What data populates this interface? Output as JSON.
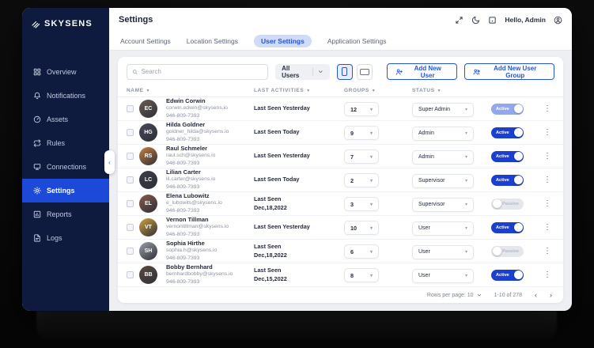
{
  "sidebar": {
    "logo_text": "SKYSENS",
    "logo_icon": "waves-signal-icon",
    "items": [
      {
        "label": "Overview",
        "icon": "dashboard-grid-icon"
      },
      {
        "label": "Notifications",
        "icon": "bell-icon"
      },
      {
        "label": "Assets",
        "icon": "gauge-icon"
      },
      {
        "label": "Rules",
        "icon": "repeat-arrows-icon"
      },
      {
        "label": "Connections",
        "icon": "monitor-icon"
      },
      {
        "label": "Settings",
        "icon": "gear-icon"
      },
      {
        "label": "Reports",
        "icon": "bar-chart-icon"
      },
      {
        "label": "Logs",
        "icon": "document-icon"
      }
    ],
    "active_item": "Settings",
    "collapse_icon": "chevron-left-icon"
  },
  "header": {
    "title": "Settings",
    "icons": [
      "expand-icon",
      "moon-icon",
      "inbox-box-icon"
    ],
    "greeting": "Hello, Admin",
    "account_icon": "account-circle-icon"
  },
  "tabs": {
    "items": [
      {
        "label": "Account Settings",
        "active": false
      },
      {
        "label": "Location Settings",
        "active": false
      },
      {
        "label": "User Settings",
        "active": true
      },
      {
        "label": "Application Settings",
        "active": false
      }
    ]
  },
  "toolbar": {
    "search_placeholder": "Search",
    "filter_value": "All Users",
    "add_user_label": "Add New User",
    "add_user_group_label": "Add New User Group",
    "accent_color": "#2453e0"
  },
  "table": {
    "columns": [
      "Name",
      "Last Activities",
      "Groups",
      "Status"
    ],
    "rows": [
      {
        "name": "Edwin Corwin",
        "email": "corwin.edwin@skysens.io",
        "phone": "946-809-7393",
        "last_seen": "Last Seen Yesterday",
        "groups": "12",
        "role": "Super Admin",
        "toggle_label": "Active",
        "toggle_state": "active",
        "toggle_variant": "light",
        "initials": "EC",
        "avatar_color": "#6b5d52"
      },
      {
        "name": "Hilda Goldner",
        "email": "goldner_hilda@skysens.io",
        "phone": "946-809-7393",
        "last_seen": "Last Seen Today",
        "groups": "9",
        "role": "Admin",
        "toggle_label": "Active",
        "toggle_state": "active",
        "toggle_variant": "",
        "initials": "HG",
        "avatar_color": "#47485a"
      },
      {
        "name": "Raul Schmeler",
        "email": "raul.sch@skysens.io",
        "phone": "946-809-7393",
        "last_seen": "Last Seen Yesterday",
        "groups": "7",
        "role": "Admin",
        "toggle_label": "Active",
        "toggle_state": "active",
        "toggle_variant": "",
        "initials": "RS",
        "avatar_color": "#c97f3c"
      },
      {
        "name": "Lilian Carter",
        "email": "lil.carter@skysens.io",
        "phone": "946-809-7393",
        "last_seen": "Last Seen Today",
        "groups": "2",
        "role": "Supervisor",
        "toggle_label": "Active",
        "toggle_state": "active",
        "toggle_variant": "",
        "initials": "LC",
        "avatar_color": "#3c3d49"
      },
      {
        "name": "Elena Lubowitz",
        "email": "e_lubowits@skysens.io",
        "phone": "946-809-7393",
        "last_seen": "Last Seen\nDec,18,2022",
        "groups": "3",
        "role": "Supervisor",
        "toggle_label": "Passive",
        "toggle_state": "passive",
        "toggle_variant": "",
        "initials": "EL",
        "avatar_color": "#8a5a4c"
      },
      {
        "name": "Vernon Tillman",
        "email": "vernontillman@skysens.io",
        "phone": "946-809-7393",
        "last_seen": "Last Seen Yesterday",
        "groups": "10",
        "role": "User",
        "toggle_label": "Active",
        "toggle_state": "active",
        "toggle_variant": "",
        "initials": "VT",
        "avatar_color": "#d2a23e"
      },
      {
        "name": "Sophia Hirthe",
        "email": "sophia.h@skysens.io",
        "phone": "946-809-7393",
        "last_seen": "Last Seen\nDec,18,2022",
        "groups": "6",
        "role": "User",
        "toggle_label": "Passive",
        "toggle_state": "passive",
        "toggle_variant": "",
        "initials": "SH",
        "avatar_color": "#9aa0a8"
      },
      {
        "name": "Bobby Bernhard",
        "email": "bernhardbobby@skysens.io",
        "phone": "946-809-7393",
        "last_seen": "Last Seen\nDec,15,2022",
        "groups": "8",
        "role": "User",
        "toggle_label": "Active",
        "toggle_state": "active",
        "toggle_variant": "",
        "initials": "BB",
        "avatar_color": "#5c4a3d"
      }
    ]
  },
  "pagination": {
    "rows_per_page_label": "Rows per page: 10",
    "range_label": "1-10 of 278",
    "prev_icon": "chevron-left-icon",
    "next_icon": "chevron-right-icon"
  }
}
